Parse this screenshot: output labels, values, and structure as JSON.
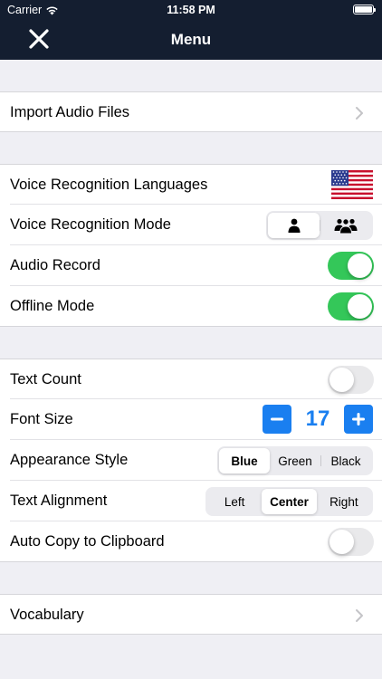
{
  "status_bar": {
    "carrier": "Carrier",
    "time": "11:58 PM"
  },
  "nav": {
    "title": "Menu",
    "close_icon": "close-icon"
  },
  "sections": {
    "import": {
      "label": "Import Audio Files"
    },
    "voice": {
      "languages_label": "Voice Recognition Languages",
      "language_flag": "us-flag-icon",
      "mode_label": "Voice Recognition Mode",
      "mode_options": [
        "single-person-icon",
        "group-icon"
      ],
      "mode_selected": 0,
      "audio_record_label": "Audio Record",
      "audio_record_on": true,
      "offline_label": "Offline Mode",
      "offline_on": true
    },
    "display": {
      "text_count_label": "Text Count",
      "text_count_on": false,
      "font_size_label": "Font Size",
      "font_size_value": "17",
      "minus_symbol": "−",
      "plus_symbol": "+",
      "appearance_label": "Appearance Style",
      "appearance_options": [
        "Blue",
        "Green",
        "Black"
      ],
      "appearance_selected": "Blue",
      "alignment_label": "Text Alignment",
      "alignment_options": [
        "Left",
        "Center",
        "Right"
      ],
      "alignment_selected": "Center",
      "auto_copy_label": "Auto Copy to Clipboard",
      "auto_copy_on": false
    },
    "vocabulary": {
      "label": "Vocabulary"
    }
  },
  "colors": {
    "nav_background": "#141e30",
    "accent_blue": "#1a7ff0",
    "toggle_on": "#34c759",
    "toggle_off": "#e9e9eb",
    "group_background": "#efeff4"
  }
}
